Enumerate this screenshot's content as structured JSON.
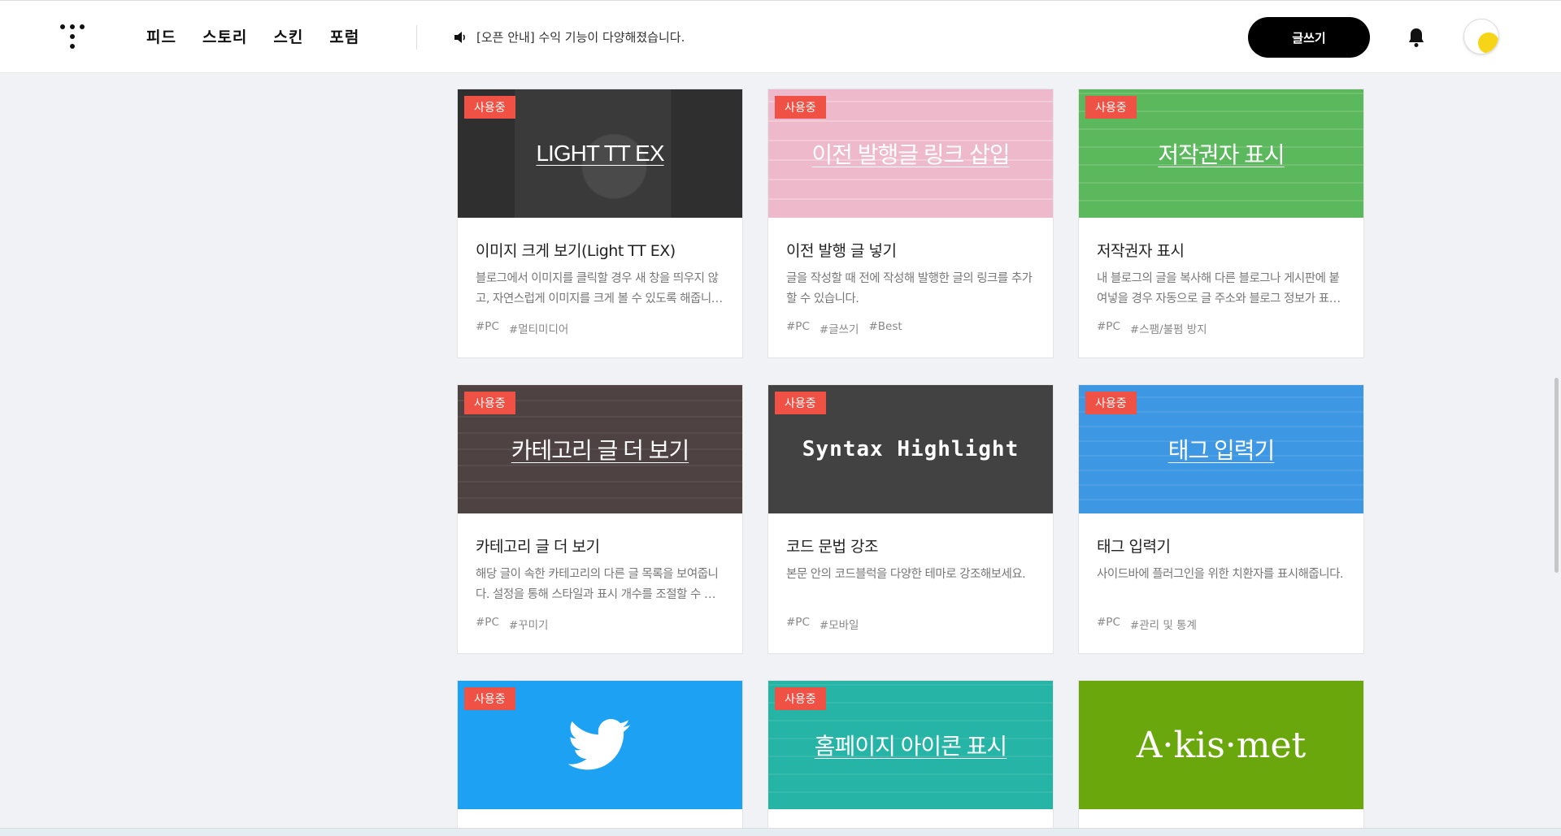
{
  "header": {
    "nav": [
      "피드",
      "스토리",
      "스킨",
      "포럼"
    ],
    "notice": "[오픈 안내] 수익 기능이 다양해졌습니다.",
    "write_label": "글쓰기",
    "logo_icon": "tistory-logo-icon",
    "speaker_icon": "speaker-icon",
    "bell_icon": "bell-icon"
  },
  "badge_label": "사용중",
  "plugins": [
    {
      "thumb_title": "LIGHT TT EX",
      "thumb_color": "#2f2f2f",
      "title": "이미지 크게 보기(Light TT EX)",
      "desc": "블로그에서 이미지를 클릭할 경우 새 창을 띄우지 않고, 자연스럽게 이미지를 크게 볼 수 있도록 해줍니다.",
      "tags": [
        "#PC",
        "#멀티미디어"
      ],
      "badge": true
    },
    {
      "thumb_title": "이전 발행글 링크 삽입",
      "thumb_color": "#eeb9cb",
      "title": "이전 발행 글 넣기",
      "desc": "글을 작성할 때 전에 작성해 발행한 글의 링크를 추가할 수 있습니다.",
      "tags": [
        "#PC",
        "#글쓰기",
        "#Best"
      ],
      "badge": true
    },
    {
      "thumb_title": "저작권자 표시",
      "thumb_color": "#5cb85c",
      "title": "저작권자 표시",
      "desc": "내 블로그의 글을 복사해 다른 블로그나 게시판에 붙여넣을 경우 자동으로 글 주소와 블로그 정보가 표시됩니다.",
      "tags": [
        "#PC",
        "#스팸/불펌 방지"
      ],
      "badge": true
    },
    {
      "thumb_title": "카테고리 글 더 보기",
      "thumb_color": "#4e4242",
      "title": "카테고리 글 더 보기",
      "desc": "해당 글이 속한 카테고리의 다른 글 목록을 보여줍니다. 설정을 통해 스타일과 표시 개수를 조절할 수 있습니다.",
      "tags": [
        "#PC",
        "#꾸미기"
      ],
      "badge": true
    },
    {
      "thumb_title": "Syntax Highlight",
      "thumb_color": "#424242",
      "title": "코드 문법 강조",
      "desc": "본문 안의 코드블럭을 다양한 테마로 강조해보세요.",
      "tags": [
        "#PC",
        "#모바일"
      ],
      "badge": true
    },
    {
      "thumb_title": "태그 입력기",
      "thumb_color": "#3d97e3",
      "title": "태그 입력기",
      "desc": "사이드바에 플러그인을 위한 치환자를 표시해줍니다.",
      "tags": [
        "#PC",
        "#관리 및 통계"
      ],
      "badge": true
    },
    {
      "thumb_title": "",
      "thumb_color": "#1da1f2",
      "title": "",
      "desc": "",
      "tags": [],
      "badge": true,
      "icon": "twitter-bird-icon"
    },
    {
      "thumb_title": "홈페이지 아이콘 표시",
      "thumb_color": "#25b4a5",
      "title": "",
      "desc": "",
      "tags": [],
      "badge": true
    },
    {
      "thumb_title": "A·kis·met",
      "thumb_color": "#6aa70c",
      "title": "",
      "desc": "",
      "tags": [],
      "badge": false
    }
  ]
}
